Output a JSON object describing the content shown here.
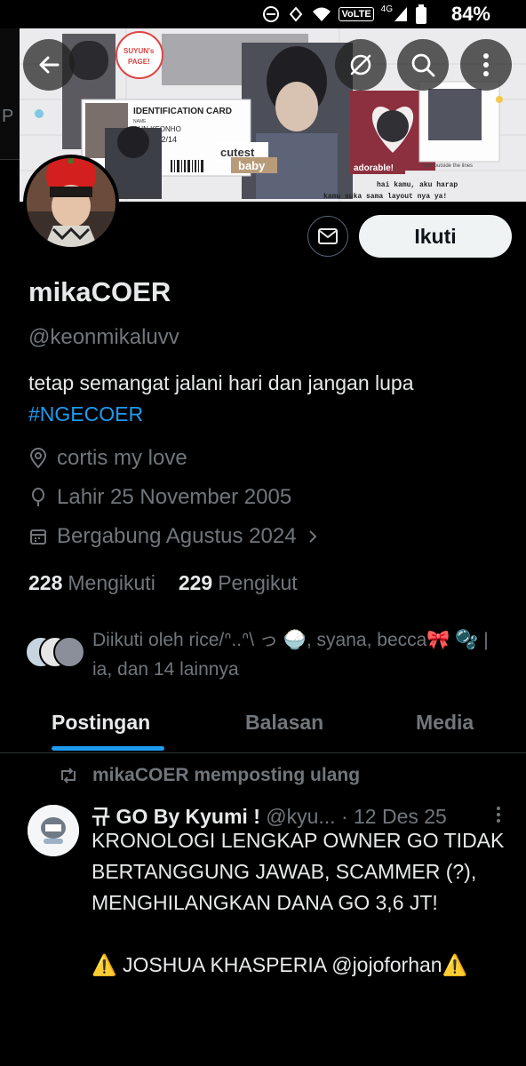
{
  "status_bar": {
    "battery_percent": "84%",
    "network": "4G",
    "volte": "VoLTE"
  },
  "header": {
    "back_icon": "arrow-left-icon",
    "grok_icon": "slash-circle-icon",
    "search_icon": "search-icon",
    "more_icon": "more-vertical-icon"
  },
  "banner": {
    "card_title": "IDENTIFICATION CARD",
    "card_name_label": "NAME",
    "card_name": "AHN KEONHO",
    "card_date": "09/02/14",
    "badge_text": "SUYUN's PAGE!",
    "sticker_cutest": "cutest",
    "sticker_baby": "baby",
    "sticker_adorable": "adorable!",
    "sticker_color": "color outside the lines",
    "note_line1": "hai kamu, aku harap",
    "note_line2": "kamu suka sama layout nya ya!"
  },
  "profile": {
    "display_name": "mikaCOER",
    "handle": "@keonmikaluvv",
    "bio": "tetap semangat jalani hari dan jangan lupa",
    "hashtag": "#NGECOER",
    "location": "cortis my love",
    "birthday": "Lahir 25 November 2005",
    "joined": "Bergabung Agustus 2024",
    "following_count": "228",
    "following_label": "Mengikuti",
    "followers_count": "229",
    "followers_label": "Pengikut",
    "followed_by": "Diikuti oleh rice/ᐢ..ᐢ\\ っ 🍚, syana, becca🎀 🫧 | ia, dan 14 lainnya",
    "follow_button": "Ikuti",
    "message_icon": "mail-icon"
  },
  "tabs": [
    {
      "label": "Postingan",
      "active": true
    },
    {
      "label": "Balasan",
      "active": false
    },
    {
      "label": "Media",
      "active": false
    }
  ],
  "post": {
    "repost_label": "mikaCOER memposting ulang",
    "author_name": "규 GO By Kyumi !",
    "author_handle": "@kyu...",
    "date": "· 12 Des 25",
    "body_lines": [
      "KRONOLOGI LENGKAP OWNER GO TIDAK BERTANGGUNG JAWAB, SCAMMER (?), MENGHILANGKAN DANA GO 3,6 JT!",
      "⚠️ JOSHUA KHASPERIA @jojoforhan⚠️"
    ]
  },
  "colors": {
    "background": "#000000",
    "accent": "#1d9bf0",
    "text_primary": "#e7e9ea",
    "text_secondary": "#71767b",
    "button_light": "#eff3f4"
  }
}
